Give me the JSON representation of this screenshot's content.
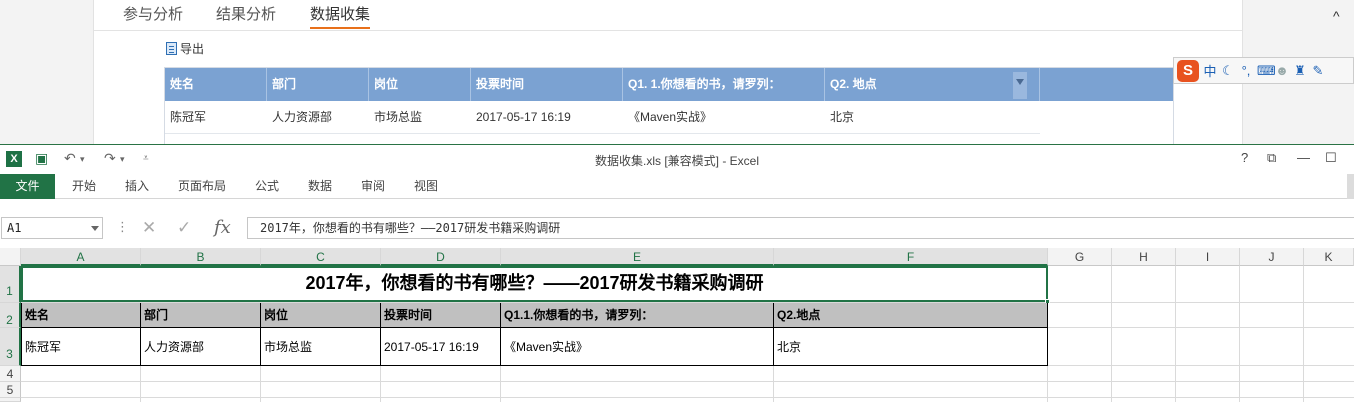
{
  "web": {
    "tabs": [
      "参与分析",
      "结果分析",
      "数据收集"
    ],
    "active_tab": "数据收集",
    "export_label": "导出",
    "collapse_glyph": "^",
    "table": {
      "headers": [
        "姓名",
        "部门",
        "岗位",
        "投票时间",
        "Q1. 1.你想看的书，请罗列：",
        "Q2. 地点"
      ],
      "rows": [
        [
          "陈冠军",
          "人力资源部",
          "市场总监",
          "2017-05-17 16:19",
          "《Maven实战》",
          "北京"
        ]
      ]
    },
    "ime": {
      "logo": "S",
      "mode": "中",
      "icons": [
        "moon-icon",
        "punctuation-icon",
        "keyboard-icon",
        "user-icon",
        "shirt-icon",
        "wrench-icon"
      ]
    }
  },
  "excel": {
    "window_title": "数据收集.xls  [兼容模式] - Excel",
    "window_controls": [
      "?",
      "⧉",
      "—",
      "☐"
    ],
    "ribbon_tabs": [
      "文件",
      "开始",
      "插入",
      "页面布局",
      "公式",
      "数据",
      "审阅",
      "视图"
    ],
    "name_box": "A1",
    "formula": "2017年，你想看的书有哪些？——2017研发书籍采购调研",
    "columns": [
      "A",
      "B",
      "C",
      "D",
      "E",
      "F",
      "G",
      "H",
      "I",
      "J",
      "K"
    ],
    "rows": [
      "1",
      "2",
      "3",
      "4",
      "5"
    ],
    "sheet_title": "2017年，你想看的书有哪些？——2017研发书籍采购调研",
    "headers": [
      "姓名",
      "部门",
      "岗位",
      "投票时间",
      "Q1.1.你想看的书，请罗列：",
      "Q2.地点"
    ],
    "data": [
      [
        "陈冠军",
        "人力资源部",
        "市场总监",
        "2017-05-17 16:19",
        "《Maven实战》",
        "北京"
      ]
    ]
  },
  "colors": {
    "excel_green": "#217346",
    "web_header_blue": "#7ba2d2",
    "tab_underline": "#e8701a",
    "header_fill": "#c0c0c0"
  }
}
